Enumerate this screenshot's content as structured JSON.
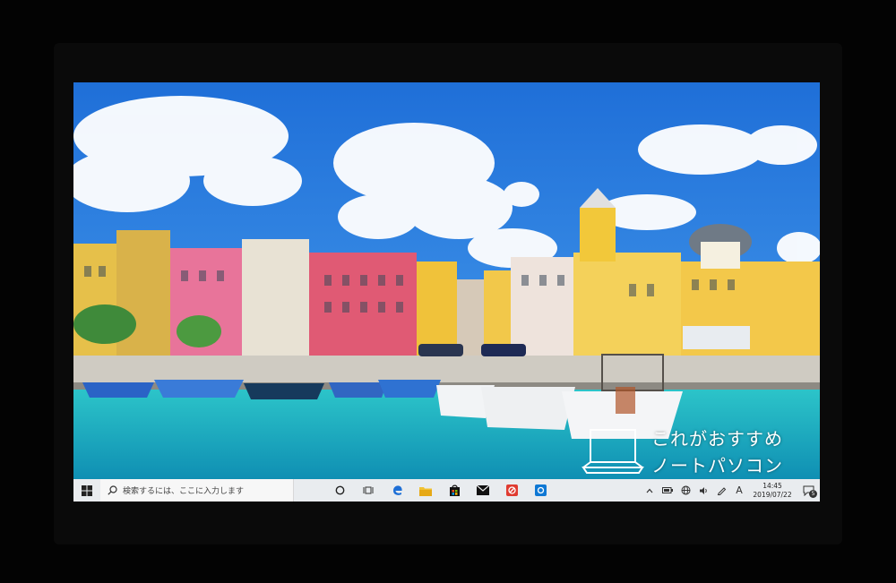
{
  "watermark": {
    "line1": "これがおすすめ",
    "line2": "ノートパソコン"
  },
  "taskbar": {
    "search_placeholder": "検索するには、ここに入力します",
    "pinned_apps": [
      "cortana-icon",
      "task-view-icon",
      "edge-icon",
      "file-explorer-icon",
      "store-icon",
      "mail-icon",
      "office-icon",
      "outlook-icon"
    ],
    "tray": {
      "ime_label": "A",
      "time": "14:45",
      "date": "2019/07/22",
      "notification_count": "5"
    }
  },
  "colors": {
    "sky": "#2a7de0",
    "sea": "#1fb5c4",
    "taskbar": "#e9ecef",
    "edge_blue": "#1e6fd6"
  }
}
